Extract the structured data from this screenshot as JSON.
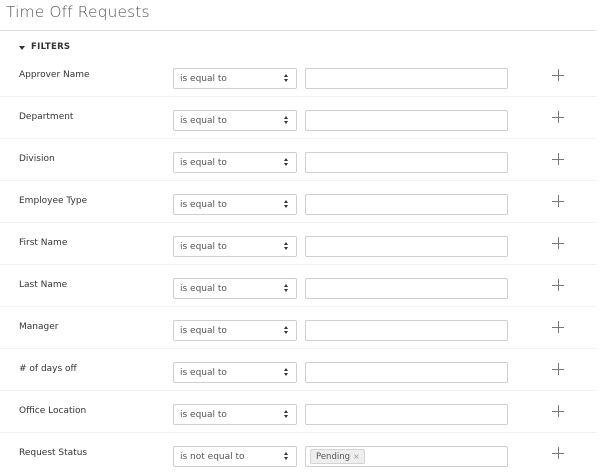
{
  "page": {
    "title": "Time Off Requests"
  },
  "filters": {
    "header_label": "FILTERS",
    "rows": [
      {
        "label": "Approver Name",
        "operator": "is equal to",
        "value": "",
        "tags": []
      },
      {
        "label": "Department",
        "operator": "is equal to",
        "value": "",
        "tags": []
      },
      {
        "label": "Division",
        "operator": "is equal to",
        "value": "",
        "tags": []
      },
      {
        "label": "Employee Type",
        "operator": "is equal to",
        "value": "",
        "tags": []
      },
      {
        "label": "First Name",
        "operator": "is equal to",
        "value": "",
        "tags": []
      },
      {
        "label": "Last Name",
        "operator": "is equal to",
        "value": "",
        "tags": []
      },
      {
        "label": "Manager",
        "operator": "is equal to",
        "value": "",
        "tags": []
      },
      {
        "label": "# of days off",
        "operator": "is equal to",
        "value": "",
        "tags": []
      },
      {
        "label": "Office Location",
        "operator": "is equal to",
        "value": "",
        "tags": []
      },
      {
        "label": "Request Status",
        "operator": "is not equal to",
        "value": "",
        "tags": [
          "Pending"
        ]
      }
    ]
  },
  "icons": {
    "collapse": "caret-down-icon",
    "add": "plus-icon",
    "select": "sort-arrows-icon",
    "remove_tag": "close-icon"
  }
}
